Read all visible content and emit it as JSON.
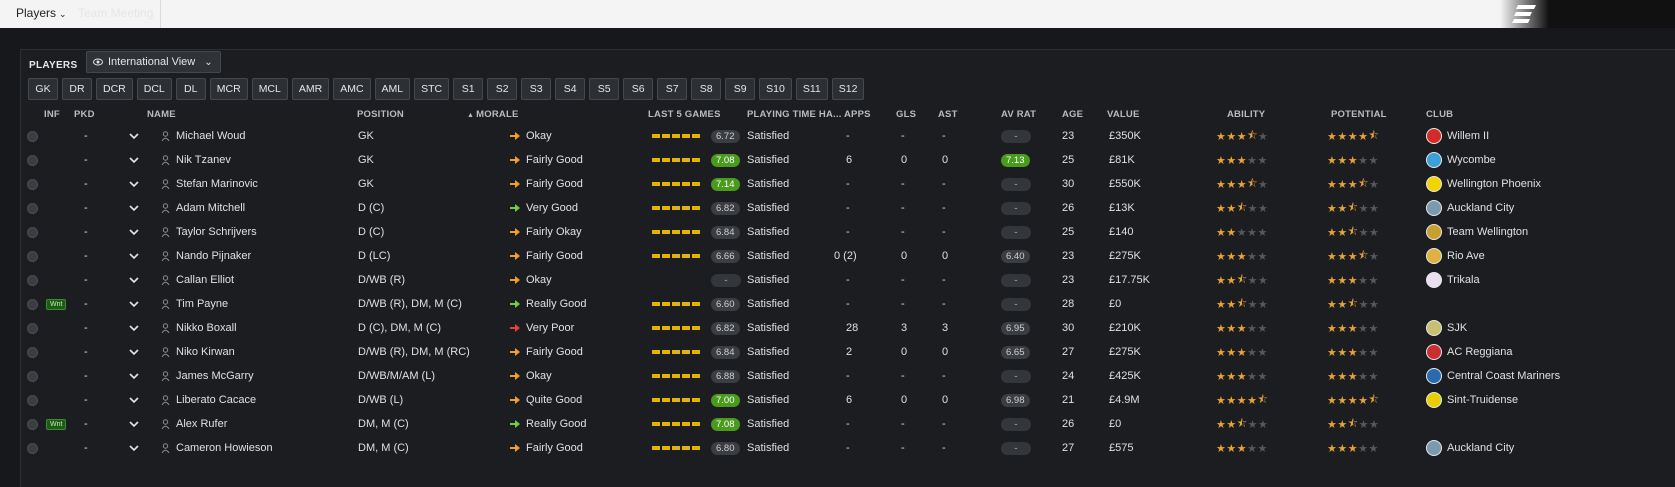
{
  "topbar": {
    "players_menu": "Players",
    "ghost_tab": "Team Meeting"
  },
  "panel": {
    "title": "PLAYERS",
    "view_select": "International View"
  },
  "position_filters": [
    "GK",
    "DR",
    "DCR",
    "DCL",
    "DL",
    "MCR",
    "MCL",
    "AMR",
    "AMC",
    "AML",
    "STC",
    "S1",
    "S2",
    "S3",
    "S4",
    "S5",
    "S6",
    "S7",
    "S8",
    "S9",
    "S10",
    "S11",
    "S12"
  ],
  "columns": {
    "inf": "INF",
    "pkd": "PKD",
    "name": "NAME",
    "position": "POSITION",
    "morale": "MORALE",
    "last5": "LAST 5 GAMES",
    "playing_time": "PLAYING TIME HA...",
    "apps": "APPS",
    "gls": "GLS",
    "ast": "AST",
    "av_rat": "AV RAT",
    "age": "AGE",
    "value": "VALUE",
    "ability": "ABILITY",
    "potential": "POTENTIAL",
    "club": "CLUB"
  },
  "colors": {
    "star": "#e8a23a",
    "form_bar": "#e6b400",
    "good_rating": "#4a9a1d",
    "morale_good": "#f0a020",
    "morale_very_good": "#6fd040",
    "morale_poor": "#e04040"
  },
  "players": [
    {
      "inf": "",
      "pkd": "-",
      "name": "Michael Woud",
      "position": "GK",
      "morale": "Okay",
      "morale_icon": "morale-okay",
      "form": "6.72",
      "form_green": false,
      "playing_time": "Satisfied",
      "apps": "-",
      "gls": "-",
      "ast": "-",
      "av_rat": "-",
      "av_green": false,
      "age": "23",
      "value": "£350K",
      "ability": 3.5,
      "potential": 4.5,
      "club": "Willem II",
      "club_color": "#d42a2a"
    },
    {
      "inf": "",
      "pkd": "-",
      "name": "Nik Tzanev",
      "position": "GK",
      "morale": "Fairly Good",
      "morale_icon": "morale-fairly-good",
      "form": "7.08",
      "form_green": true,
      "playing_time": "Satisfied",
      "apps": "6",
      "gls": "0",
      "ast": "0",
      "av_rat": "7.13",
      "av_green": true,
      "age": "25",
      "value": "£81K",
      "ability": 3.0,
      "potential": 3.0,
      "club": "Wycombe",
      "club_color": "#3aa0d8"
    },
    {
      "inf": "",
      "pkd": "-",
      "name": "Stefan Marinovic",
      "position": "GK",
      "morale": "Fairly Good",
      "morale_icon": "morale-fairly-good",
      "form": "7.14",
      "form_green": true,
      "playing_time": "Satisfied",
      "apps": "-",
      "gls": "-",
      "ast": "-",
      "av_rat": "-",
      "av_green": false,
      "age": "30",
      "value": "£550K",
      "ability": 3.5,
      "potential": 3.5,
      "club": "Wellington Phoenix",
      "club_color": "#f2d500"
    },
    {
      "inf": "",
      "pkd": "-",
      "name": "Adam Mitchell",
      "position": "D (C)",
      "morale": "Very Good",
      "morale_icon": "morale-very-good",
      "form": "6.82",
      "form_green": false,
      "playing_time": "Satisfied",
      "apps": "-",
      "gls": "-",
      "ast": "-",
      "av_rat": "-",
      "av_green": false,
      "age": "26",
      "value": "£13K",
      "ability": 2.5,
      "potential": 2.5,
      "club": "Auckland City",
      "club_color": "#7a9ab0"
    },
    {
      "inf": "",
      "pkd": "-",
      "name": "Taylor Schrijvers",
      "position": "D (C)",
      "morale": "Fairly Okay",
      "morale_icon": "morale-fairly-okay",
      "form": "6.84",
      "form_green": false,
      "playing_time": "Satisfied",
      "apps": "-",
      "gls": "-",
      "ast": "-",
      "av_rat": "-",
      "av_green": false,
      "age": "25",
      "value": "£140",
      "ability": 2.0,
      "potential": 2.5,
      "club": "Team Wellington",
      "club_color": "#c8a030"
    },
    {
      "inf": "",
      "pkd": "-",
      "name": "Nando Pijnaker",
      "position": "D (LC)",
      "morale": "Fairly Good",
      "morale_icon": "morale-fairly-good",
      "form": "6.66",
      "form_green": false,
      "playing_time": "Satisfied",
      "apps": "0 (2)",
      "gls": "0",
      "ast": "0",
      "av_rat": "6.40",
      "av_green": false,
      "age": "23",
      "value": "£275K",
      "ability": 3.0,
      "potential": 3.5,
      "club": "Rio Ave",
      "club_color": "#e0b040"
    },
    {
      "inf": "",
      "pkd": "-",
      "name": "Callan Elliot",
      "position": "D/WB (R)",
      "morale": "Okay",
      "morale_icon": "morale-okay",
      "form": "-",
      "form_green": false,
      "playing_time": "Satisfied",
      "apps": "-",
      "gls": "-",
      "ast": "-",
      "av_rat": "-",
      "av_green": false,
      "age": "23",
      "value": "£17.75K",
      "ability": 2.5,
      "potential": 3.0,
      "club": "Trikala",
      "club_color": "#e8e0f0"
    },
    {
      "inf": "Wnt",
      "pkd": "-",
      "name": "Tim Payne",
      "position": "D/WB (R), DM, M (C)",
      "morale": "Really Good",
      "morale_icon": "morale-really-good",
      "form": "6.60",
      "form_green": false,
      "playing_time": "Satisfied",
      "apps": "-",
      "gls": "-",
      "ast": "-",
      "av_rat": "-",
      "av_green": false,
      "age": "28",
      "value": "£0",
      "ability": 2.5,
      "potential": 2.5,
      "club": "",
      "club_color": ""
    },
    {
      "inf": "",
      "pkd": "-",
      "name": "Nikko Boxall",
      "position": "D (C), DM, M (C)",
      "morale": "Very Poor",
      "morale_icon": "morale-very-poor",
      "form": "6.82",
      "form_green": false,
      "playing_time": "Satisfied",
      "apps": "28",
      "gls": "3",
      "ast": "3",
      "av_rat": "6.95",
      "av_green": false,
      "age": "30",
      "value": "£210K",
      "ability": 3.0,
      "potential": 3.0,
      "club": "SJK",
      "club_color": "#c8c070"
    },
    {
      "inf": "",
      "pkd": "-",
      "name": "Niko Kirwan",
      "position": "D/WB (R), DM, M (RC)",
      "morale": "Fairly Good",
      "morale_icon": "morale-fairly-good",
      "form": "6.84",
      "form_green": false,
      "playing_time": "Satisfied",
      "apps": "2",
      "gls": "0",
      "ast": "0",
      "av_rat": "6.65",
      "av_green": false,
      "age": "27",
      "value": "£275K",
      "ability": 3.0,
      "potential": 3.0,
      "club": "AC Reggiana",
      "club_color": "#c83030"
    },
    {
      "inf": "",
      "pkd": "-",
      "name": "James McGarry",
      "position": "D/WB/M/AM (L)",
      "morale": "Okay",
      "morale_icon": "morale-okay",
      "form": "6.88",
      "form_green": false,
      "playing_time": "Satisfied",
      "apps": "-",
      "gls": "-",
      "ast": "-",
      "av_rat": "-",
      "av_green": false,
      "age": "24",
      "value": "£425K",
      "ability": 3.0,
      "potential": 3.0,
      "club": "Central Coast Mariners",
      "club_color": "#2a6ab0"
    },
    {
      "inf": "",
      "pkd": "-",
      "name": "Liberato Cacace",
      "position": "D/WB (L)",
      "morale": "Quite Good",
      "morale_icon": "morale-quite-good",
      "form": "7.00",
      "form_green": true,
      "playing_time": "Satisfied",
      "apps": "6",
      "gls": "0",
      "ast": "0",
      "av_rat": "6.98",
      "av_green": false,
      "age": "21",
      "value": "£4.9M",
      "ability": 4.5,
      "potential": 4.5,
      "club": "Sint-Truidense",
      "club_color": "#e8d000"
    },
    {
      "inf": "Wnt",
      "pkd": "-",
      "name": "Alex Rufer",
      "position": "DM, M (C)",
      "morale": "Really Good",
      "morale_icon": "morale-really-good",
      "form": "7.08",
      "form_green": true,
      "playing_time": "Satisfied",
      "apps": "-",
      "gls": "-",
      "ast": "-",
      "av_rat": "-",
      "av_green": false,
      "age": "26",
      "value": "£0",
      "ability": 2.5,
      "potential": 2.5,
      "club": "",
      "club_color": ""
    },
    {
      "inf": "",
      "pkd": "-",
      "name": "Cameron Howieson",
      "position": "DM, M (C)",
      "morale": "Fairly Good",
      "morale_icon": "morale-fairly-good",
      "form": "6.80",
      "form_green": false,
      "playing_time": "Satisfied",
      "apps": "-",
      "gls": "-",
      "ast": "-",
      "av_rat": "-",
      "av_green": false,
      "age": "27",
      "value": "£575",
      "ability": 3.0,
      "potential": 3.0,
      "club": "Auckland City",
      "club_color": "#7a9ab0"
    }
  ]
}
